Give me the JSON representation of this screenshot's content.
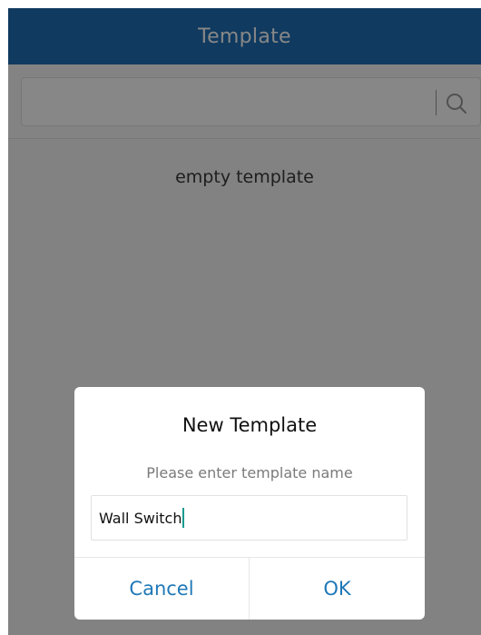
{
  "header": {
    "title": "Template"
  },
  "search": {
    "value": "",
    "icon": "search-icon"
  },
  "list": {
    "empty_text": "empty template"
  },
  "dialog": {
    "title": "New Template",
    "subtitle": "Please enter template name",
    "input_value": "Wall Switch",
    "cancel_label": "Cancel",
    "ok_label": "OK"
  },
  "colors": {
    "header_bg": "#1f6fb5",
    "accent": "#1f78b8",
    "caret": "#139c8e"
  }
}
